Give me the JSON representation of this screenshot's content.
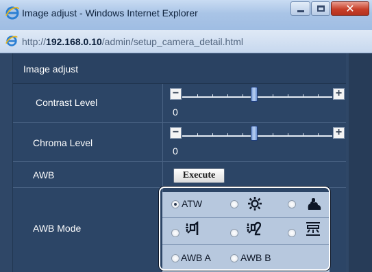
{
  "window": {
    "title": "Image adjust - Windows Internet Explorer",
    "close_glyph": "✕"
  },
  "address": {
    "url_prefix": "http://",
    "url_host": "192.168.0.10",
    "url_path": "/admin/setup_camera_detail.html"
  },
  "panel": {
    "header": "Image adjust",
    "contrast": {
      "label": "Contrast Level",
      "value": "0",
      "minus": "−",
      "plus": "+"
    },
    "chroma": {
      "label": "Chroma Level",
      "value": "0",
      "minus": "−",
      "plus": "+"
    },
    "awb": {
      "label": "AWB",
      "button": "Execute"
    },
    "awb_mode": {
      "label": "AWB Mode",
      "options": {
        "atw": "ATW",
        "awb_a": "AWB A",
        "awb_b": "AWB B"
      },
      "selected": "ATW",
      "icons": [
        "sun-icon",
        "cloud-icon",
        "indoor-lamp-1-icon",
        "indoor-lamp-2-icon",
        "fluorescent-icon"
      ]
    }
  },
  "colors": {
    "panel_bg": "#2c4566",
    "highlight_border": "#ffffff",
    "option_bg": "#b7c8de"
  }
}
